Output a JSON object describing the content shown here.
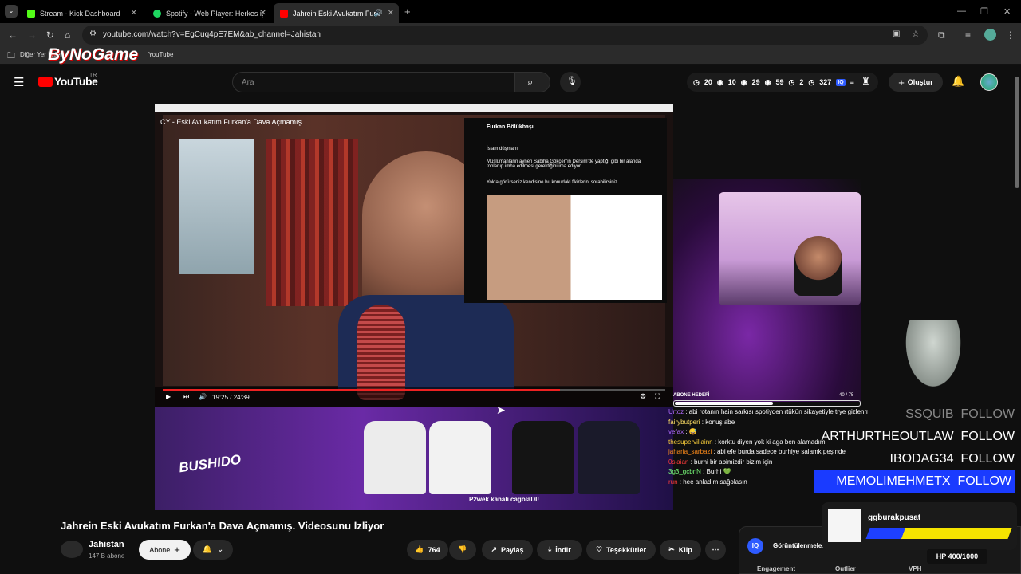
{
  "browser": {
    "tabs": [
      {
        "title": "Stream - Kick Dashboard",
        "fav": "#53fc18"
      },
      {
        "title": "Spotify - Web Player: Herkes için",
        "fav": "#1ed760"
      },
      {
        "title": "Jahrein Eski Avukatım Furkan",
        "fav": "#ff0000"
      }
    ],
    "url": "youtube.com/watch?v=EgCuq4pE7EM&ab_channel=Jahistan",
    "bookmarks": {
      "folder": "Diğer Yer İmleri",
      "youtube": "YouTube"
    },
    "watermark": "ByNoGame"
  },
  "youtube": {
    "logo": "YouTube",
    "logo_region": "TR",
    "search_placeholder": "Ara",
    "stats": [
      "20",
      "10",
      "29",
      "59",
      "2",
      "327"
    ],
    "create_label": "Oluştur"
  },
  "video": {
    "inner_title": "CY - Eski Avukatım Furkan'a Dava Açmamış.",
    "time": "19:25 / 24:39",
    "progress": 0.79,
    "tweet_author": "Furkan Bölükbaşı",
    "tweet_lines": [
      "İslam düşmanı",
      "Müslümanların aynen Sabiha Gökçen'in Dersim'de yaptığı gibi bir alanda toplanıp imha edilmesi gerektiğini ima ediyor",
      "Yolda görürseniz kendisine bu konudaki fikirlerini sorabilirsiniz"
    ],
    "goal_label": "ABONE HEDEFİ",
    "goal_count": "40 / 75",
    "goal_fraction": 0.53,
    "brand": "BUSHIDO",
    "promo": "P2wek kanalı cagolaDI!",
    "chat": [
      {
        "user": "Urtoz",
        "color": "#b26bff",
        "msg": "abi rotanın hain sarkısı spotiyden rtükün sikayetiyle trye gizlenmis @Jahrein"
      },
      {
        "user": "fairybutperi",
        "color": "#ffe066",
        "msg": "konuş abe"
      },
      {
        "user": "vefax",
        "color": "#b26bff",
        "msg": "😅"
      },
      {
        "user": "thesupervillainn",
        "color": "#ffd23b",
        "msg": "korktu diyen yok ki aga ben alamadım"
      },
      {
        "user": "jaharia_sarbazi",
        "color": "#ff8c1a",
        "msg": "abi efe burda sadece burhiye salamk peşinde"
      },
      {
        "user": "0slaian",
        "color": "#ff3b3b",
        "msg": "burhi bir abimizdir bizim için"
      },
      {
        "user": "3g3_gcbnN",
        "color": "#7aff7a",
        "msg": "Burhi 💚"
      },
      {
        "user": "run",
        "color": "#ff3b3b",
        "msg": "hee anladım sağolasın"
      }
    ],
    "follows": [
      {
        "name": "SSQUIB",
        "label": "FOLLOW"
      },
      {
        "name": "ARTHURTHEOUTLAW",
        "label": "FOLLOW"
      },
      {
        "name": "IBODAG34",
        "label": "FOLLOW"
      },
      {
        "name": "MEMOLIMEHMETX",
        "label": "FOLLOW"
      }
    ],
    "overlay_user": "ggburakpusat",
    "hp": "HP 400/1000"
  },
  "below": {
    "title": "Jahrein Eski Avukatım Furkan'a Dava Açmamış. Videosunu İzliyor",
    "channel": "Jahistan",
    "subs": "147 B abone",
    "subscribe": "Abone",
    "likes": "764",
    "share": "Paylaş",
    "download": "İndir",
    "thanks": "Teşekkürler",
    "clip": "Klip",
    "panel_title": "Görüntülenmeler",
    "panel_cols": [
      "Engagement",
      "Outlier",
      "VPH"
    ],
    "panel_badge": "IQ"
  }
}
